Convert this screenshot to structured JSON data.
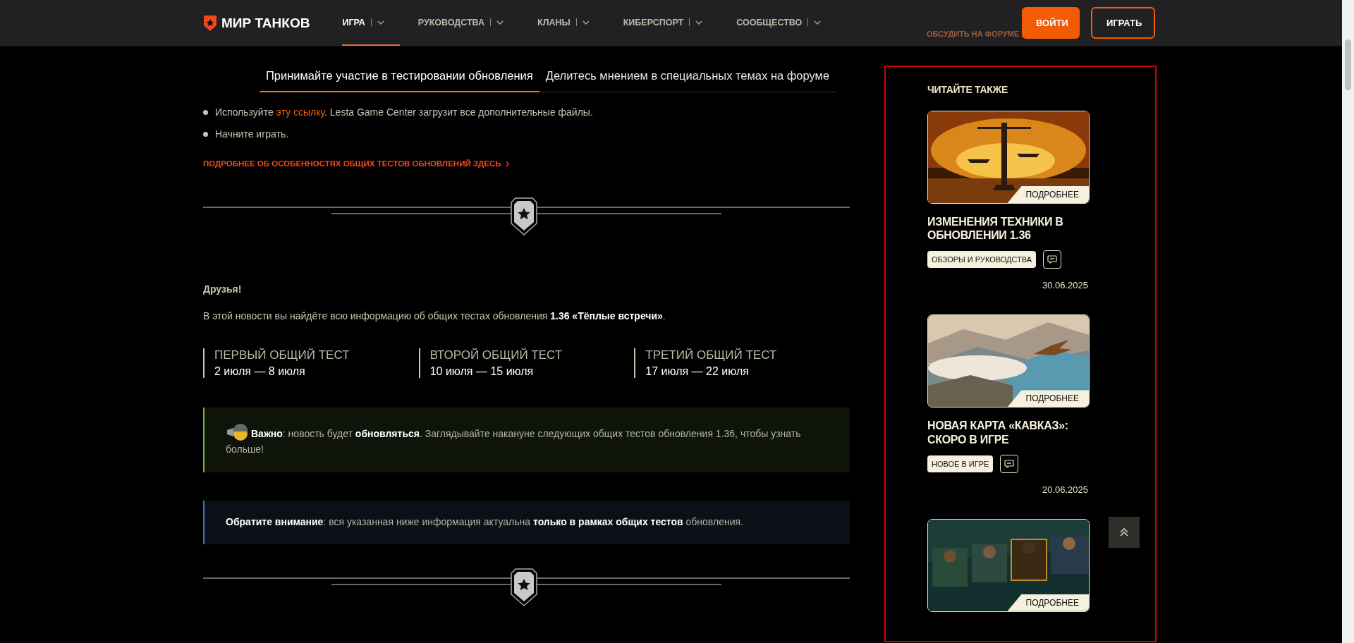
{
  "header": {
    "logo": "МИР ТАНКОВ",
    "nav": [
      {
        "label": "ИГРА",
        "selected": true
      },
      {
        "label": "РУКОВОДСТВА",
        "selected": false
      },
      {
        "label": "КЛАНЫ",
        "selected": false
      },
      {
        "label": "КИБЕРСПОРТ",
        "selected": false
      },
      {
        "label": "СООБЩЕСТВО",
        "selected": false
      }
    ],
    "login_button": "ВОЙТИ",
    "play_button": "ИГРАТЬ",
    "forum_link": "ОБСУДИТЬ НА ФОРУМЕ"
  },
  "article": {
    "tabs": [
      {
        "label": "Принимайте участие в тестировании обновления",
        "selected": true
      },
      {
        "label": "Делитесь мнением в специальных темах на форуме",
        "selected": false
      }
    ],
    "steps": [
      {
        "before": "Используйте ",
        "link": "эту ссылку",
        "after": ". Lesta Game Center загрузит все дополнительные файлы."
      },
      {
        "before": "Начните играть."
      }
    ],
    "more_link": "ПОДРОБНЕЕ ОБ ОСОБЕННОСТЯХ ОБЩИХ ТЕСТОВ ОБНОВЛЕНИЙ ЗДЕСЬ",
    "greeting": "Друзья!",
    "intro": "В этой новости вы найдёте всю информацию об общих тестах обновления **1.36 «Тёплые встречи»**.",
    "tests": [
      {
        "name": "ПЕРВЫЙ ОБЩИЙ ТЕСТ",
        "dates": "2 июля — 8 июля"
      },
      {
        "name": "ВТОРОЙ ОБЩИЙ ТЕСТ",
        "dates": "10 июля — 15 июля"
      },
      {
        "name": "ТРЕТИЙ ОБЩИЙ ТЕСТ",
        "dates": "17 июля — 22 июля"
      }
    ],
    "notes": [
      {
        "kind": "important",
        "text": "**Важно**: новость будет **обновляться**. Заглядывайте накануне следующих общих тестов обновления 1.36, чтобы узнать больше!"
      },
      {
        "kind": "attention",
        "text": "**Обратите внимание**: вся указанная ниже информация актуальна **только в рамках общих тестов** обновления."
      }
    ]
  },
  "sidebar": {
    "title": "ЧИТАЙТЕ ТАКЖЕ",
    "articles": [
      {
        "more_label": "ПОДРОБНЕЕ",
        "title": "ИЗМЕНЕНИЯ ТЕХНИКИ В ОБНОВЛЕНИИ 1.36",
        "tag": "ОБЗОРЫ И РУКОВОДСТВА",
        "date": "30.06.2025"
      },
      {
        "more_label": "ПОДРОБНЕЕ",
        "title": "НОВАЯ КАРТА «КАВКАЗ»: СКОРО В ИГРЕ",
        "tag": "НОВОЕ В ИГРЕ",
        "date": "20.06.2025"
      },
      {
        "more_label": "ПОДРОБНЕЕ"
      }
    ]
  }
}
